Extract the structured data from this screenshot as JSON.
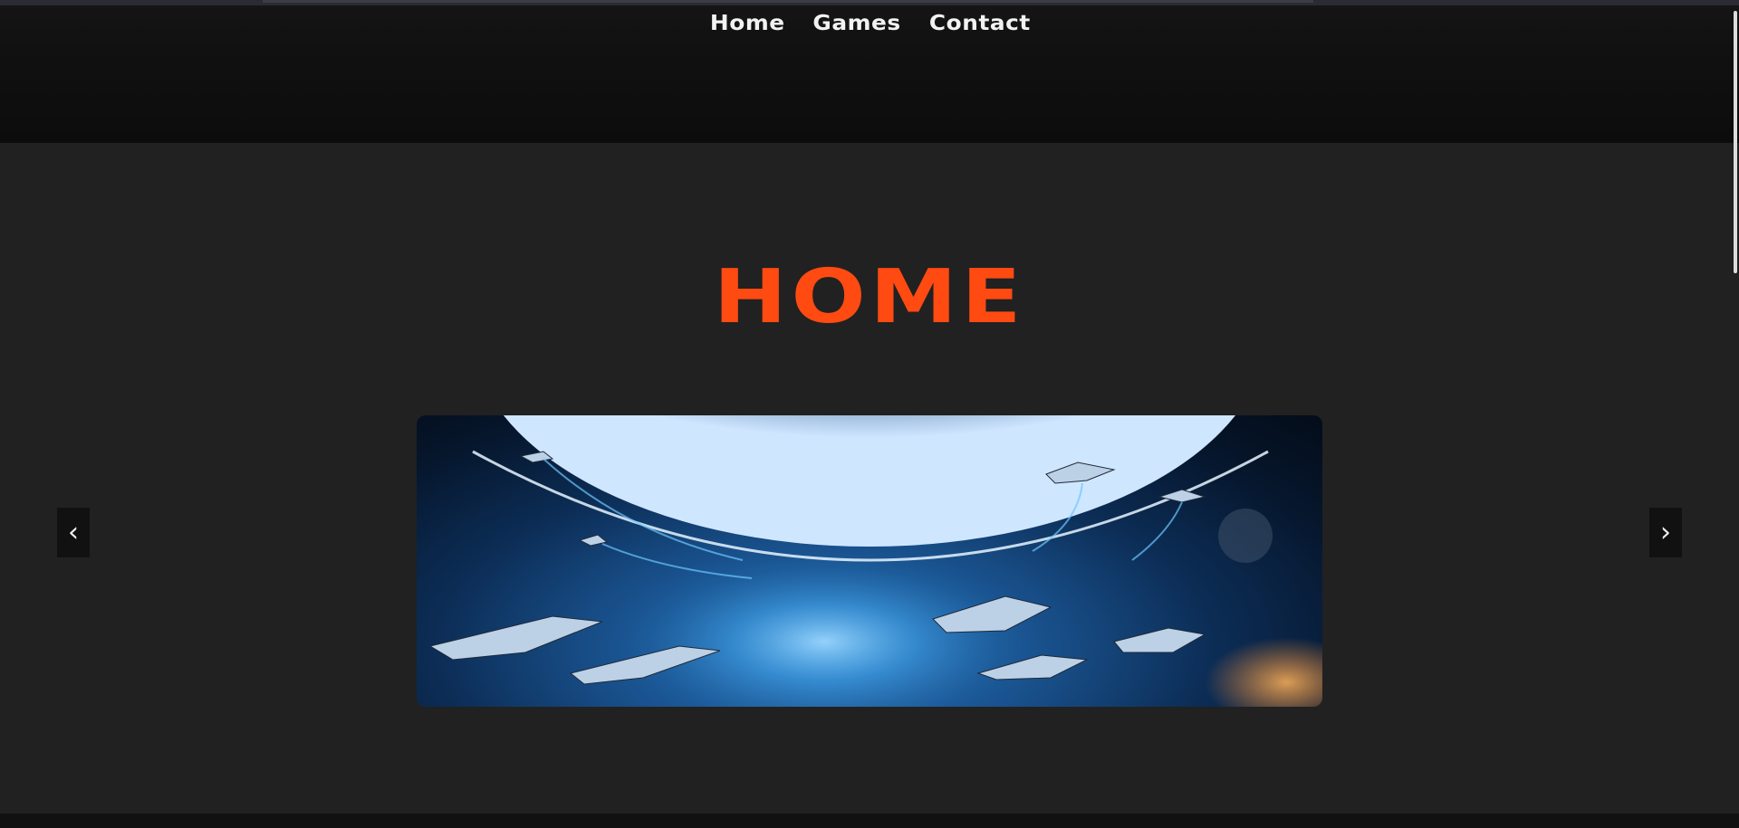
{
  "nav": {
    "items": [
      "Home",
      "Games",
      "Contact"
    ]
  },
  "page": {
    "title": "HOME"
  },
  "carousel": {
    "prev_label": "‹",
    "next_label": "›",
    "slide_description": ""
  },
  "colors": {
    "accent": "#ff4a12",
    "background": "#212121",
    "header": "#0c0c0c"
  }
}
